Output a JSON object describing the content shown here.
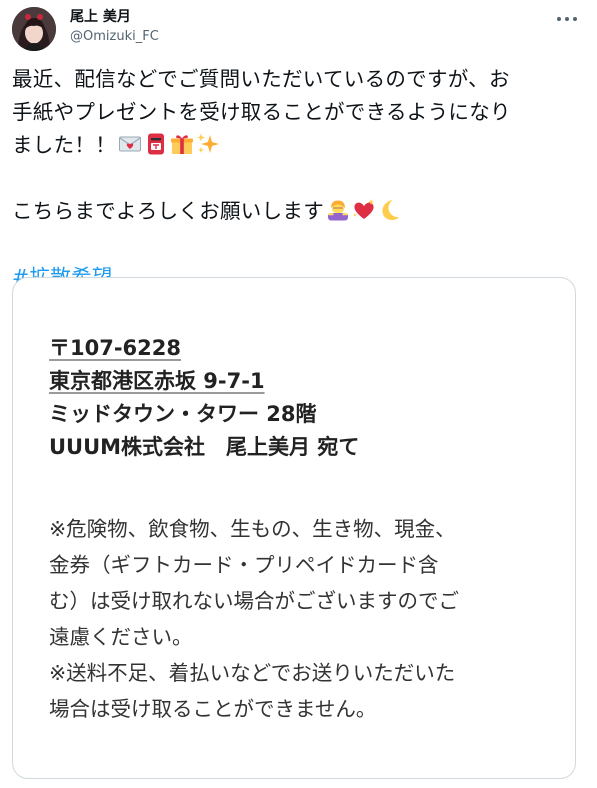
{
  "header": {
    "display_name": "尾上 美月",
    "handle": "@Omizuki_FC",
    "avatar_icon": "avatar-photo",
    "more_icon": "more-dots-icon"
  },
  "tweet": {
    "line1": "最近、配信などでご質問いただいているのですが、お",
    "line2": "手紙やプレゼントを受け取ることができるようになり",
    "line3": "ました！！",
    "line3_emojis": [
      "envelope-heart-icon",
      "postbox-icon",
      "gift-icon",
      "sparkles-icon"
    ],
    "line4": "こちらまでよろしくお願いします",
    "line4_emojis": [
      "woman-bowing-icon",
      "sparkling-heart-icon",
      "crescent-moon-icon"
    ],
    "hashtag": "#拡散希望"
  },
  "media": {
    "address": {
      "postal": "〒107-6228",
      "city": "東京都港区赤坂 9-7-1",
      "building": "ミッドタウン・タワー 28階",
      "recipient": "UUUM株式会社　尾上美月 宛て"
    },
    "notes": [
      "※危険物、飲食物、生もの、生き物、現金、",
      "金券（ギフトカード・プリペイドカード含",
      "む）は受け取れない場合がございますのでご",
      "遠慮ください。",
      "※送料不足、着払いなどでお送りいただいた",
      "場合は受け取ることができません。"
    ]
  },
  "colors": {
    "hashtag": "#1d9bf0",
    "text": "#0f1419",
    "muted": "#536471",
    "card_border": "#cfd9de"
  }
}
